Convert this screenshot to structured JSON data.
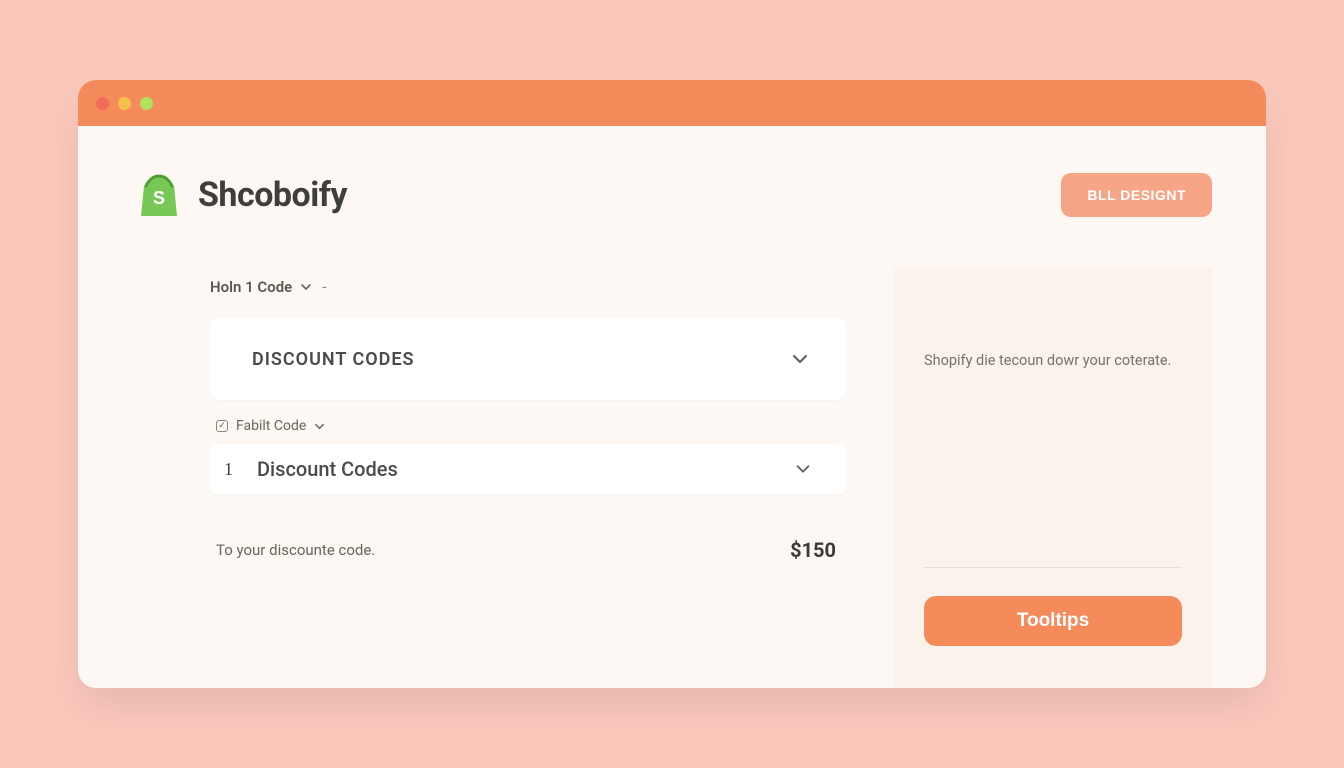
{
  "brand": {
    "name": "Shcoboify"
  },
  "header": {
    "cta_label": "BLL DESIGNT"
  },
  "main": {
    "field_label": "Holn 1 Code",
    "field_trail": "-",
    "card1_title": "DISCOUNT CODES",
    "sublabel": "Fabilt Code",
    "card2_index": "1",
    "card2_title": "Discount Codes",
    "hint": "To your discounte code.",
    "price": "$150"
  },
  "side": {
    "text": "Shopify die tecoun dowr your coterate.",
    "button_label": "Tooltips"
  }
}
